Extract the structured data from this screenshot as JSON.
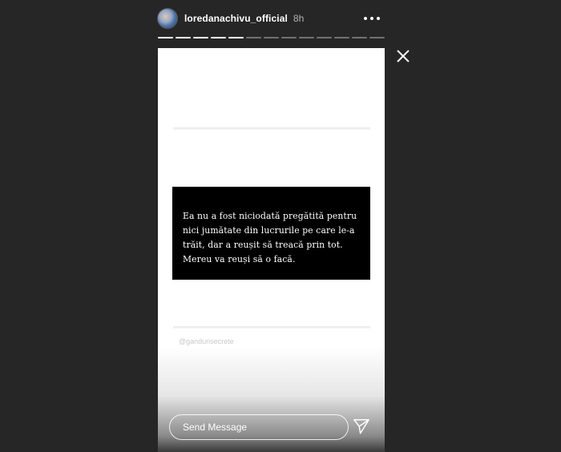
{
  "header": {
    "username": "loredanachivu_official",
    "time": "8h",
    "avatar_icon": "profile-photo",
    "more_icon": "more-horizontal-icon"
  },
  "progress": {
    "total_segments": 13,
    "completed_segments": 5
  },
  "story": {
    "quote": "Ea nu a fost niciodată pregătită pentru nici jumătate din lucrurile pe care le-a trăit, dar a reușit să treacă prin tot. Mereu va reuși să o facă.",
    "handle": "@gandurisecrete"
  },
  "message": {
    "placeholder": "Send Message",
    "send_icon": "send-icon"
  },
  "close_icon": "close-icon",
  "colors": {
    "background": "#262626",
    "story_background": "#ffffff",
    "quote_box": "#000000"
  }
}
